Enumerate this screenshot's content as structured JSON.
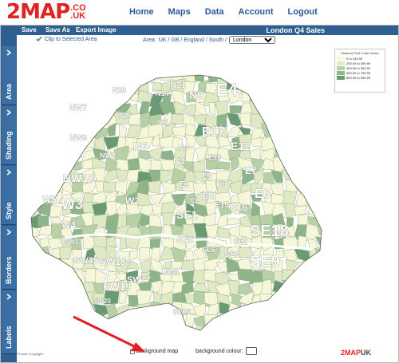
{
  "header": {
    "logo_main": "2MAP",
    "logo_tld_1": ".CO",
    "logo_tld_2": ".UK",
    "nav": [
      "Home",
      "Maps",
      "Data",
      "Account",
      "Logout"
    ]
  },
  "toolbar": {
    "save": "Save",
    "save_as": "Save As",
    "export": "Export Image",
    "title": "London Q4 Sales"
  },
  "subbar": {
    "clip_label": "Clip to Selected Area",
    "area_label": "Area:",
    "area_breadcrumb": "UK / GB / England / South /",
    "area_selected": "London"
  },
  "sidebar": {
    "tabs": [
      "Area",
      "Shading",
      "Style",
      "Borders",
      "Labels"
    ]
  },
  "legend": {
    "title": "Value by Post Code Sector",
    "rows": [
      {
        "label": "0   to   199.99",
        "color": "#f6f7d9"
      },
      {
        "label": "200.00 to   399.99",
        "color": "#dfe9c4"
      },
      {
        "label": "400.00 to   599.99",
        "color": "#b8d0a6"
      },
      {
        "label": "600.00 to   799.99",
        "color": "#8fb48a"
      },
      {
        "label": "800.00 to   999.99",
        "color": "#6a9a74"
      }
    ]
  },
  "map": {
    "labels": [
      "N20",
      "N21",
      "N14",
      "N9",
      "E4",
      "NW7",
      "N2",
      "N11",
      "E17",
      "N4",
      "NW9",
      "N6",
      "NW2",
      "NW10",
      "N1",
      "E10",
      "E11",
      "E7",
      "E3",
      "E6",
      "W5",
      "W3",
      "W2",
      "W4",
      "E16",
      "SE28",
      "SW13",
      "SW15",
      "SW18",
      "SW17",
      "SW19",
      "SW20",
      "SE2",
      "SE3",
      "SE18",
      "SE9",
      "SE1",
      "SE5",
      "SE6",
      "SE21",
      "SE25",
      "E2",
      "E1",
      "E8",
      "E5",
      "E15"
    ]
  },
  "footer": {
    "copyright": "©Crown Copyright",
    "bg_map_label": "background map",
    "bg_colour_label": "background colour:",
    "watermark_main": "2MAP",
    "watermark_suffix": "UK"
  }
}
